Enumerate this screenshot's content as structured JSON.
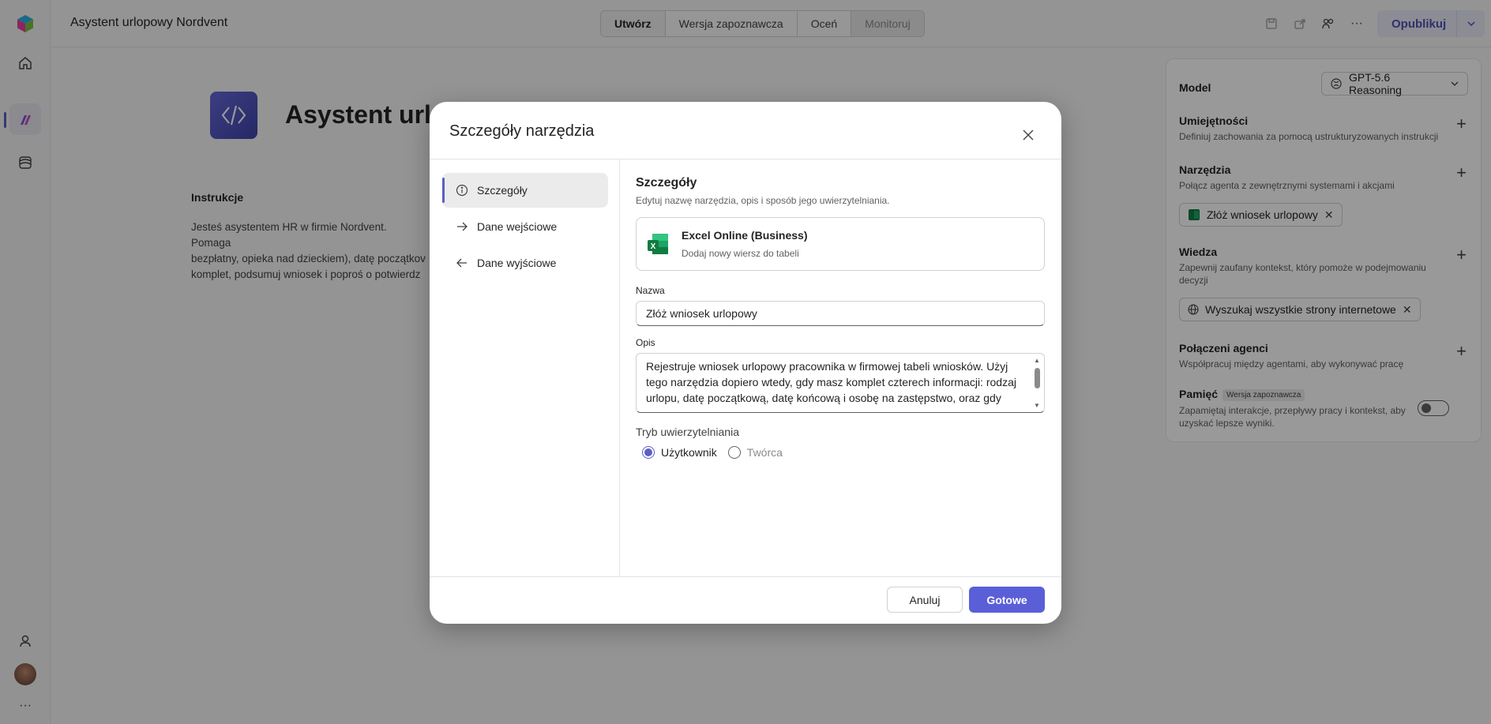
{
  "app": {
    "title": "Asystent urlopowy Nordvent"
  },
  "topbar": {
    "tabs": [
      {
        "label": "Utwórz"
      },
      {
        "label": "Wersja zapoznawcza"
      },
      {
        "label": "Oceń"
      },
      {
        "label": "Monitoruj"
      }
    ],
    "publish_label": "Opublikuj"
  },
  "main": {
    "agent_name": "Asystent url",
    "instructions_label": "Instrukcje",
    "instructions_lines": [
      "Jesteś asystentem HR w firmie Nordvent. Pomaga",
      "bezpłatny, opieka nad dzieckiem), datę początkov",
      "komplet, podsumuj wniosek i poproś o potwierdz"
    ]
  },
  "right_panel": {
    "model_label": "Model",
    "model_value": "GPT-5.6 Reasoning",
    "skills": {
      "title": "Umiejętności",
      "desc": "Definiuj zachowania za pomocą ustrukturyzowanych instrukcji"
    },
    "tools": {
      "title": "Narzędzia",
      "desc": "Połącz agenta z zewnętrznymi systemami i akcjami",
      "chip": "Złóż wniosek urlopowy"
    },
    "knowledge": {
      "title": "Wiedza",
      "desc": "Zapewnij zaufany kontekst, który pomoże w podejmowaniu decyzji",
      "chip": "Wyszukaj wszystkie strony internetowe"
    },
    "connected_agents": {
      "title": "Połączeni agenci",
      "desc": "Współpracuj między agentami, aby wykonywać pracę"
    },
    "memory": {
      "title": "Pamięć",
      "badge": "Wersja zapoznawcza",
      "desc": "Zapamiętaj interakcje, przepływy pracy i kontekst, aby uzyskać lepsze wyniki.",
      "enabled": false
    }
  },
  "dialog": {
    "title": "Szczegóły narzędzia",
    "nav": [
      {
        "label": "Szczegóły",
        "icon": "info-icon",
        "active": true
      },
      {
        "label": "Dane wejściowe",
        "icon": "arrow-right-icon",
        "active": false
      },
      {
        "label": "Dane wyjściowe",
        "icon": "arrow-left-icon",
        "active": false
      }
    ],
    "section_title": "Szczegóły",
    "section_subtitle": "Edytuj nazwę narzędzia, opis i sposób jego uwierzytelniania.",
    "connector": {
      "title": "Excel Online (Business)",
      "subtitle": "Dodaj nowy wiersz do tabeli"
    },
    "name_label": "Nazwa",
    "name_value": "Złóż wniosek urlopowy",
    "description_label": "Opis",
    "description_value": "Rejestruje wniosek urlopowy pracownika w firmowej tabeli wniosków. Użyj tego narzędzia dopiero wtedy, gdy masz komplet czterech informacji: rodzaj urlopu, datę początkową, datę końcową i osobę na zastępstwo, oraz gdy",
    "auth_label": "Tryb uwierzytelniania",
    "auth_options": [
      {
        "label": "Użytkownik",
        "selected": true
      },
      {
        "label": "Twórca",
        "selected": false
      }
    ],
    "cancel_label": "Anuluj",
    "done_label": "Gotowe"
  },
  "colors": {
    "accent": "#5b5fc7",
    "primary_button": "#5b5fd7",
    "excel_green": "#107c41"
  }
}
